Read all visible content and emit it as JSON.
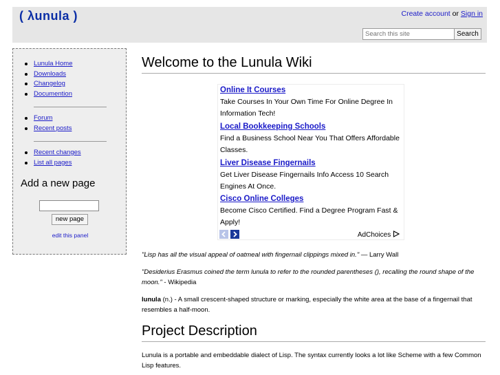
{
  "header": {
    "logo": "( λunula )",
    "create_account": "Create account",
    "or": " or ",
    "sign_in": "Sign in",
    "search_placeholder": "Search this site",
    "search_button": "Search"
  },
  "sidebar": {
    "group1": [
      {
        "label": "Lunula Home"
      },
      {
        "label": "Downloads"
      },
      {
        "label": "Changelog"
      },
      {
        "label": "Documention"
      }
    ],
    "group2": [
      {
        "label": "Forum"
      },
      {
        "label": "Recent posts"
      }
    ],
    "group3": [
      {
        "label": "Recent changes"
      },
      {
        "label": "List all pages"
      }
    ],
    "add_page_title": "Add a new page",
    "new_page_button": "new page",
    "edit_panel": "edit this panel"
  },
  "main": {
    "title": "Welcome to the Lunula Wiki",
    "ads": [
      {
        "title": "Online It Courses",
        "text": "Take Courses In Your Own Time For Online Degree In Information Tech!"
      },
      {
        "title": "Local Bookkeeping Schools",
        "text": "Find a Business School Near You That Offers Affordable Classes."
      },
      {
        "title": "Liver Disease Fingernails",
        "text": "Get Liver Disease Fingernails Info Access 10 Search Engines At Once."
      },
      {
        "title": "Cisco Online Colleges",
        "text": "Become Cisco Certified. Find a Degree Program Fast & Apply!"
      }
    ],
    "adchoices": "AdChoices",
    "quote1": {
      "text": "\"Lisp has all the visual appeal of oatmeal with fingernail clippings mixed in.\"",
      "attribution": " — Larry Wall"
    },
    "quote2": {
      "text": "\"Desiderius Erasmus coined the term lunula to refer to the rounded parentheses (), recalling the round shape of the moon.\"",
      "attribution": " - Wikipedia"
    },
    "definition": {
      "term": "lunula",
      "text": " (n.) - A small crescent-shaped structure or marking, especially the white area at the base of a fingernail that resembles a half-moon."
    },
    "section_title": "Project Description",
    "description": "Lunula is a portable and embeddable dialect of Lisp. The syntax currently looks a lot like Scheme with a few Common Lisp features."
  },
  "colors": {
    "link": "#1a1ac8",
    "logo": "#0b2ea6",
    "header_bg": "#e6e6e6",
    "sidebar_bg": "#eeeeee"
  }
}
